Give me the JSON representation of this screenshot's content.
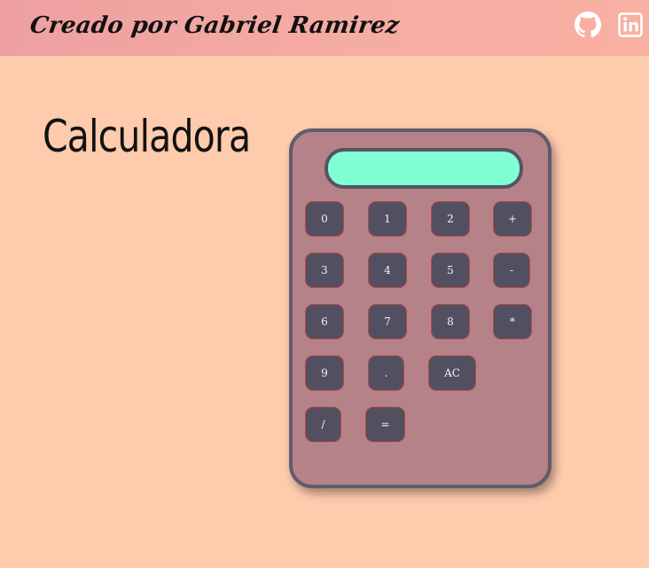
{
  "header": {
    "author_text": "Creado por Gabriel Ramirez",
    "github_icon": "github-icon",
    "linkedin_icon": "linkedin-icon"
  },
  "page_title": "Calculadora",
  "calculator": {
    "display_value": "",
    "keys": [
      "0",
      "1",
      "2",
      "+",
      "3",
      "4",
      "5",
      "-",
      "6",
      "7",
      "8",
      "*",
      "9",
      ".",
      "AC",
      "/",
      "="
    ]
  },
  "colors": {
    "background": "#fecbad",
    "header": "#f5aca2",
    "calculator_body": "#b6828a",
    "display": "#80ffd6",
    "key": "#525060",
    "key_border": "#b2484a"
  }
}
